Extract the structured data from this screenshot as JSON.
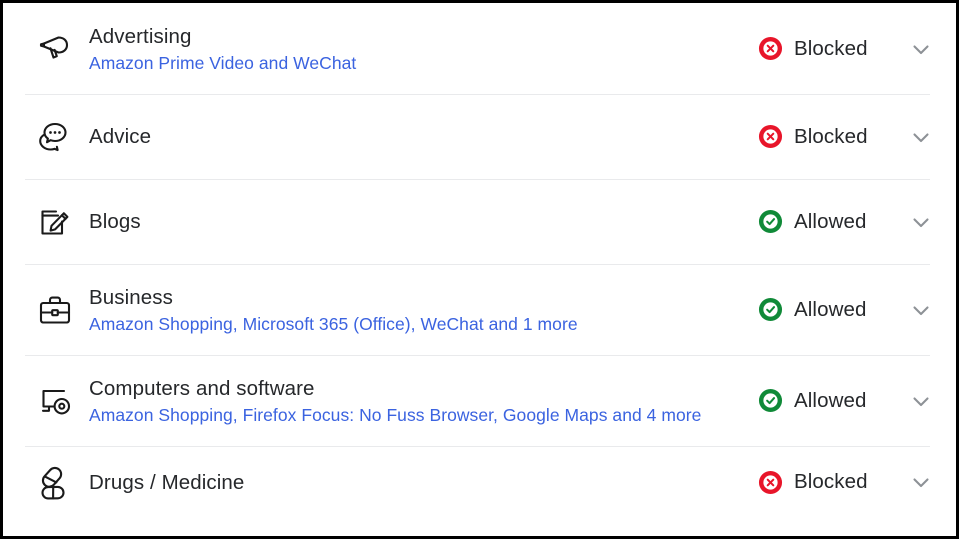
{
  "theme": {
    "link_color": "#3b63e0",
    "text_color": "#26282b",
    "blocked_color": "#e8152a",
    "allowed_color": "#108a38",
    "divider_color": "#e9eaec",
    "chevron_color": "#8d9196"
  },
  "status_labels": {
    "blocked": "Blocked",
    "allowed": "Allowed"
  },
  "categories": [
    {
      "icon": "megaphone-icon",
      "title": "Advertising",
      "apps": "Amazon Prime Video and WeChat",
      "status": "Blocked",
      "status_icon": "blocked-circle-x-icon",
      "chevron": "chevron-down-icon"
    },
    {
      "icon": "speech-bubble-icon",
      "title": "Advice",
      "apps": "",
      "status": "Blocked",
      "status_icon": "blocked-circle-x-icon",
      "chevron": "chevron-down-icon"
    },
    {
      "icon": "pencil-square-icon",
      "title": "Blogs",
      "apps": "",
      "status": "Allowed",
      "status_icon": "allowed-circle-check-icon",
      "chevron": "chevron-down-icon"
    },
    {
      "icon": "briefcase-icon",
      "title": "Business",
      "apps": "Amazon Shopping, Microsoft 365 (Office), WeChat and 1 more",
      "status": "Allowed",
      "status_icon": "allowed-circle-check-icon",
      "chevron": "chevron-down-icon"
    },
    {
      "icon": "monitor-icon",
      "title": "Computers and software",
      "apps": "Amazon Shopping, Firefox Focus: No Fuss Browser, Google Maps and 4 more",
      "status": "Allowed",
      "status_icon": "allowed-circle-check-icon",
      "chevron": "chevron-down-icon"
    },
    {
      "icon": "pills-icon",
      "title": "Drugs / Medicine",
      "apps": "",
      "status": "Blocked",
      "status_icon": "blocked-circle-x-icon",
      "chevron": "chevron-down-icon"
    }
  ]
}
